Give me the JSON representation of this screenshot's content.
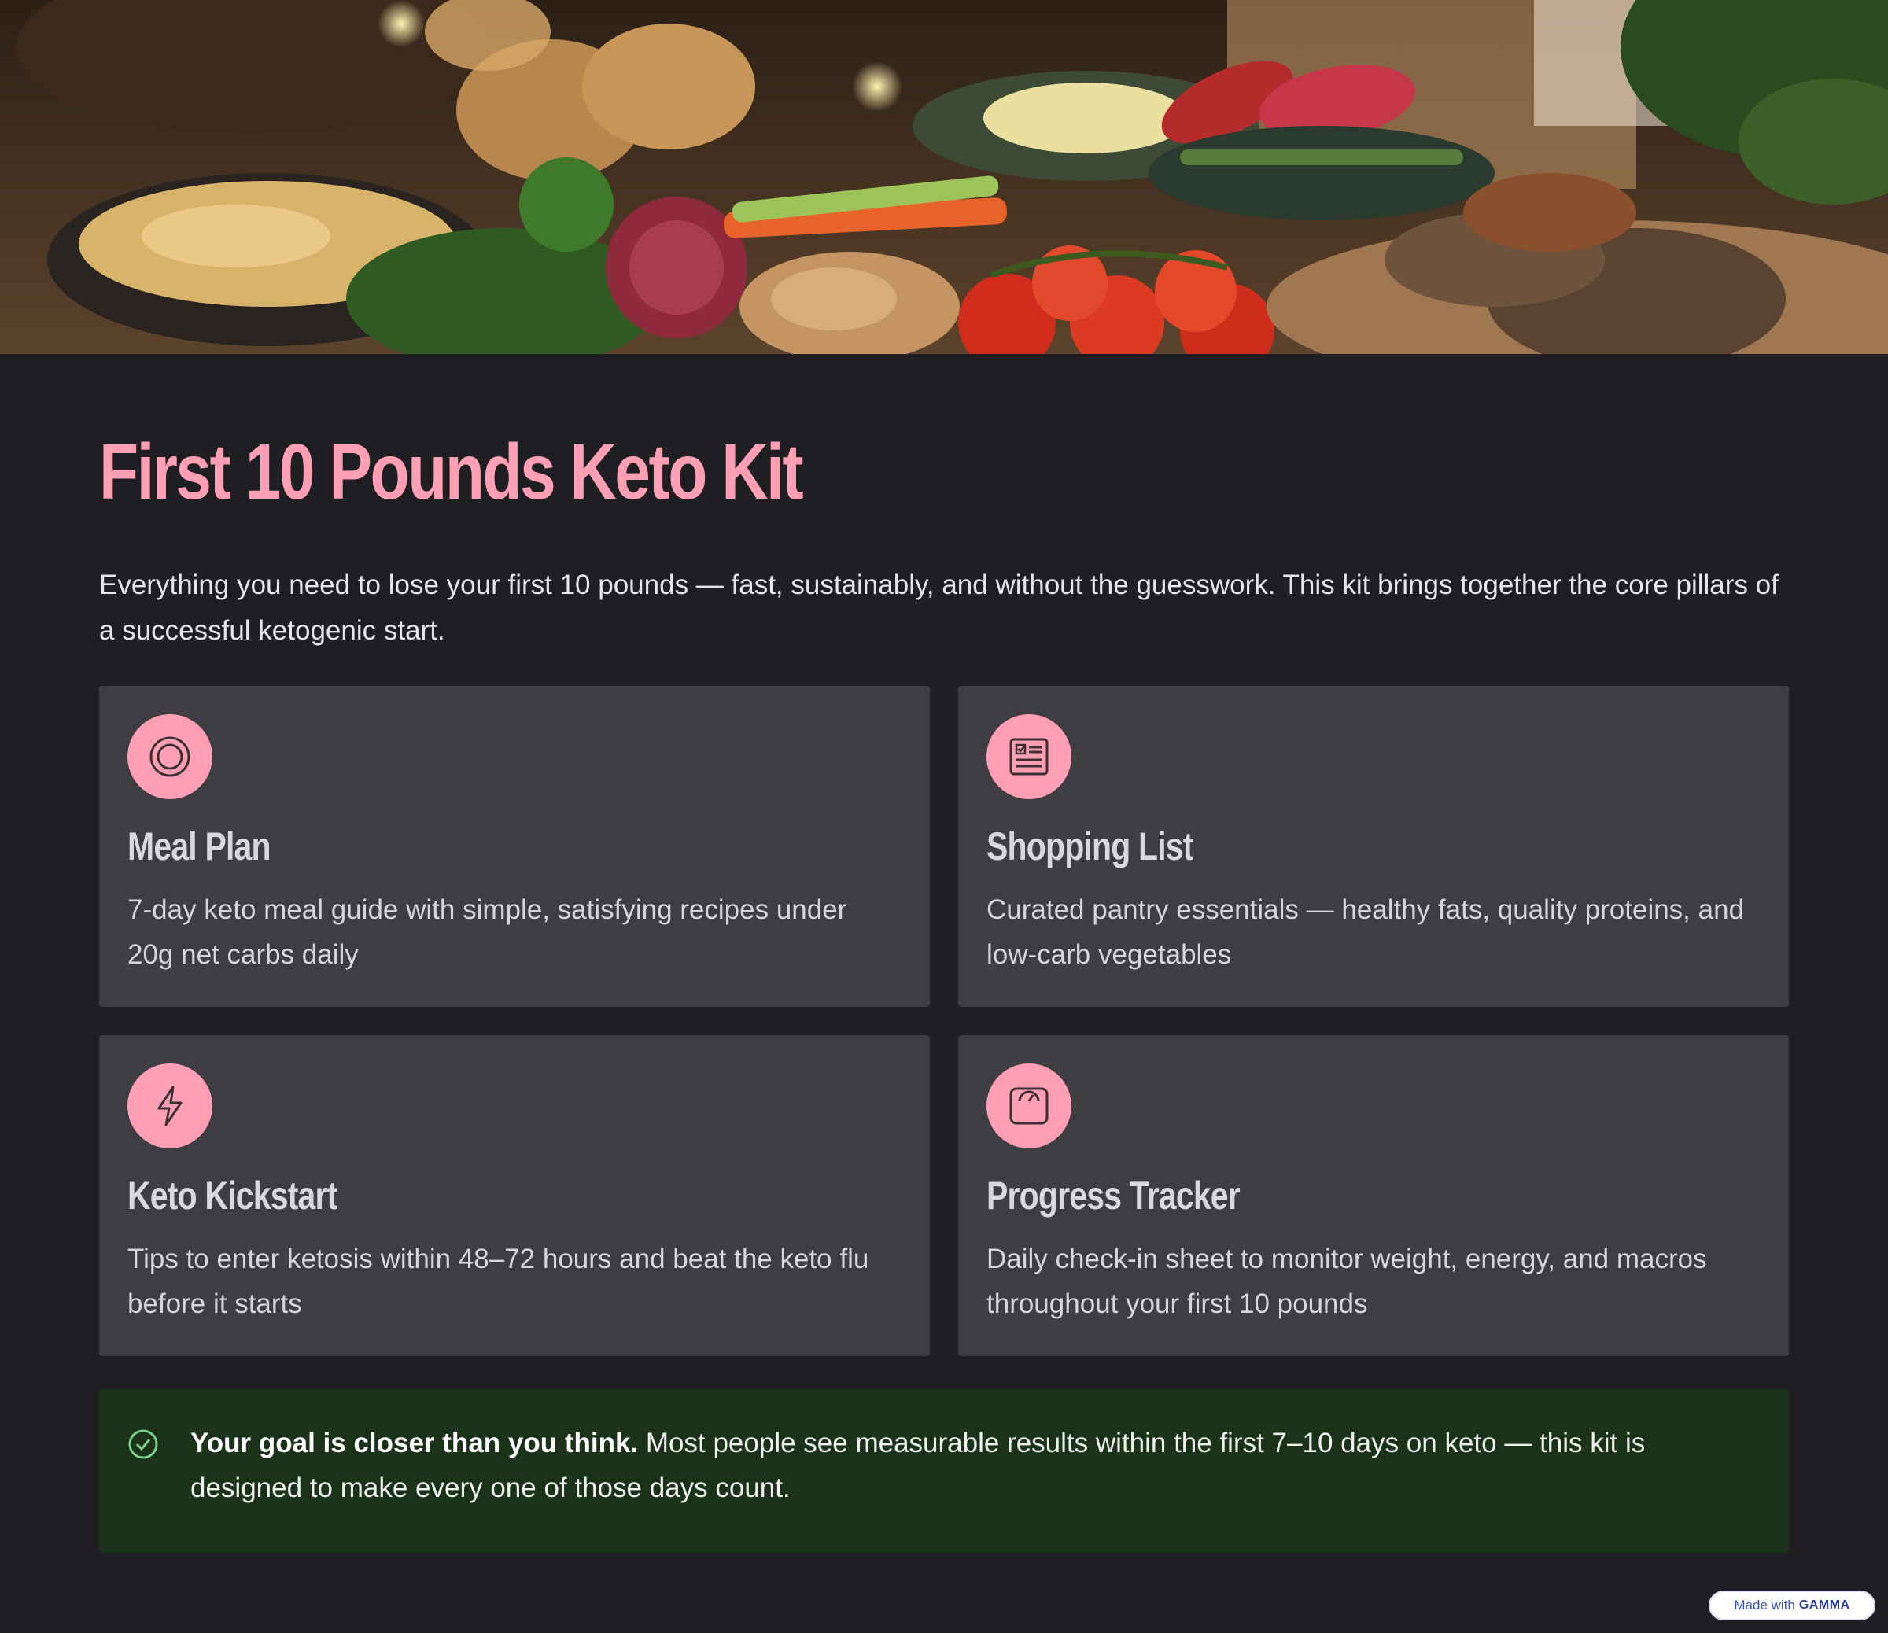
{
  "hero": {
    "image_description_icon": "food-photo"
  },
  "title": "First 10 Pounds Keto Kit",
  "intro": "Everything you need to lose your first 10 pounds — fast, sustainably, and without the guesswork. This kit brings together the core pillars of a successful ketogenic start.",
  "cards": [
    {
      "icon": "plate-icon",
      "title": "Meal Plan",
      "desc": "7-day keto meal guide with simple, satisfying recipes under 20g net carbs daily"
    },
    {
      "icon": "checklist-icon",
      "title": "Shopping List",
      "desc": "Curated pantry essentials — healthy fats, quality proteins, and low-carb vegetables"
    },
    {
      "icon": "lightning-icon",
      "title": "Keto Kickstart",
      "desc": "Tips to enter ketosis within 48–72 hours and beat the keto flu before it starts"
    },
    {
      "icon": "scale-icon",
      "title": "Progress Tracker",
      "desc": "Daily check-in sheet to monitor weight, energy, and macros throughout your first 10 pounds"
    }
  ],
  "callout": {
    "icon": "check-circle-icon",
    "bold": "Your goal is closer than you think.",
    "text": " Most people see measurable results within the first 7–10 days on keto — this kit is designed to make every one of those days count."
  },
  "badge": {
    "prefix": "Made with",
    "brand": "GAMMA"
  },
  "colors": {
    "accent": "#ff9fb4",
    "background": "#1f1e22",
    "card": "#3e3d41",
    "callout": "#1a3318"
  }
}
